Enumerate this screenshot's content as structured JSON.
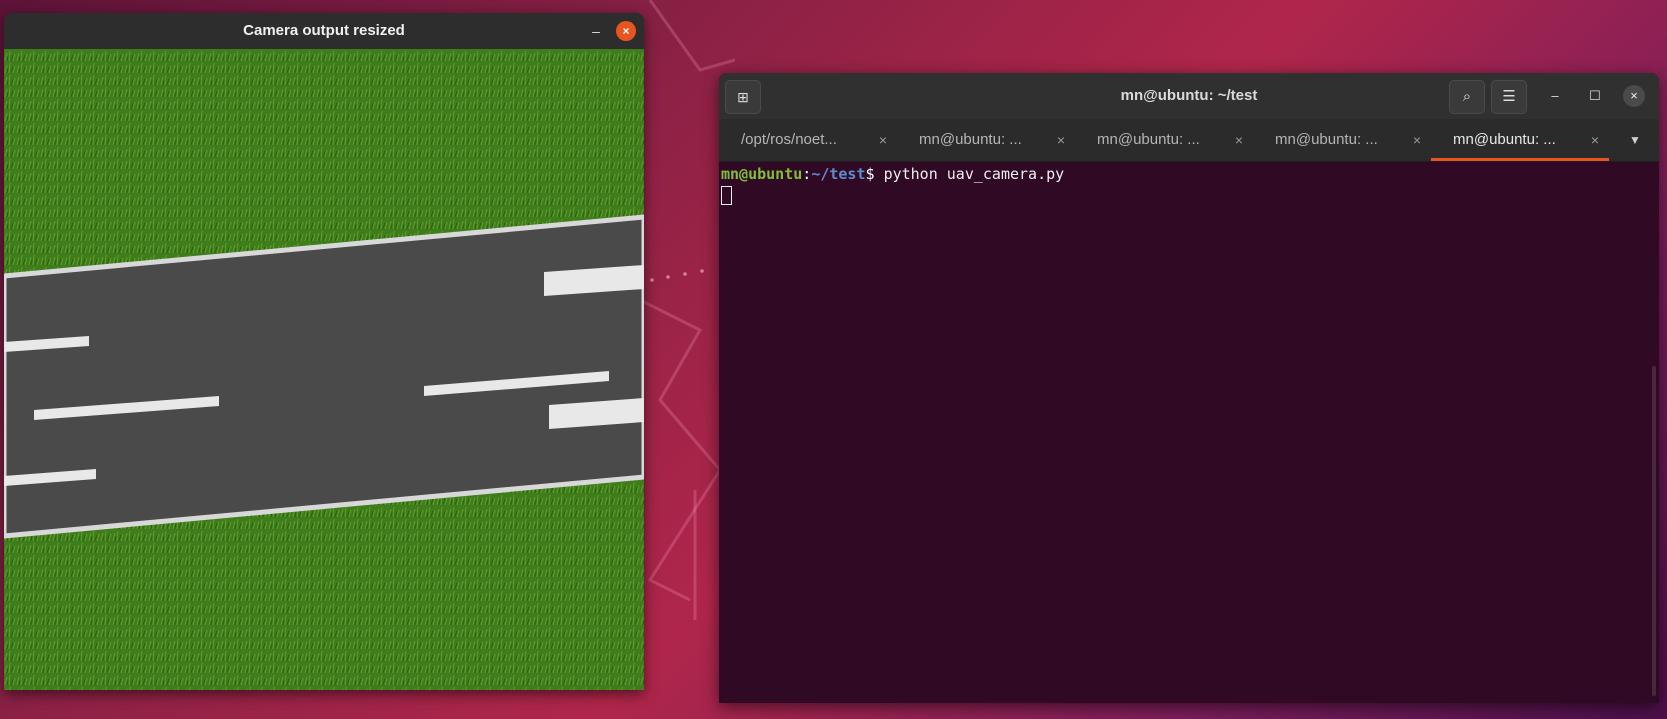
{
  "camera_window": {
    "title": "Camera output resized",
    "minimize_label": "–",
    "close_label": "×"
  },
  "terminal_window": {
    "new_tab_icon": "⊞",
    "title": "mn@ubuntu: ~/test",
    "search_icon": "⌕",
    "menu_icon": "☰",
    "minimize_label": "–",
    "maximize_label": "☐",
    "close_label": "×",
    "tabs": [
      {
        "label": "/opt/ros/noet...",
        "close": "×",
        "active": false
      },
      {
        "label": "mn@ubuntu: ...",
        "close": "×",
        "active": false
      },
      {
        "label": "mn@ubuntu: ...",
        "close": "×",
        "active": false
      },
      {
        "label": "mn@ubuntu: ...",
        "close": "×",
        "active": false
      },
      {
        "label": "mn@ubuntu: ...",
        "close": "×",
        "active": true
      }
    ],
    "tab_dropdown": "▼",
    "prompt": {
      "user_host": "mn@ubuntu",
      "colon": ":",
      "path": "~/test",
      "symbol": "$ ",
      "command": "python uav_camera.py"
    }
  },
  "colors": {
    "accent": "#e95420",
    "terminal_bg": "#300a24",
    "grass": "#3f7d1c",
    "road": "#4a4a4a"
  }
}
